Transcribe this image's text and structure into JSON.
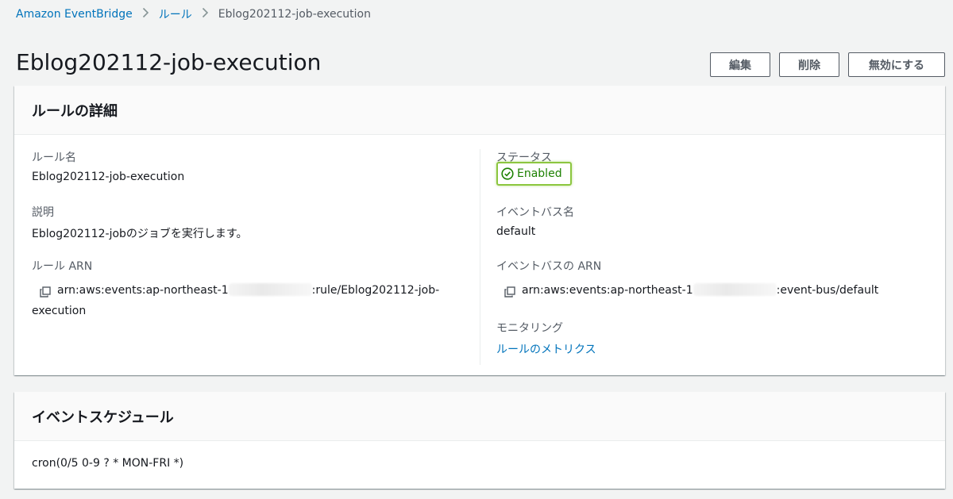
{
  "breadcrumb": {
    "root": "Amazon EventBridge",
    "rules": "ルール",
    "current": "Eblog202112-job-execution"
  },
  "page": {
    "title": "Eblog202112-job-execution"
  },
  "actions": {
    "edit": "編集",
    "delete": "削除",
    "disable": "無効にする"
  },
  "rule_details": {
    "heading": "ルールの詳細",
    "name_label": "ルール名",
    "name_value": "Eblog202112-job-execution",
    "description_label": "説明",
    "description_value": "Eblog202112-jobのジョブを実行します。",
    "arn_label": "ルール ARN",
    "arn_prefix": "arn:aws:events:ap-northeast-1",
    "arn_suffix": ":rule/Eblog202112-job-",
    "arn_wrap": "execution",
    "status_label": "ステータス",
    "status_value": "Enabled",
    "bus_label": "イベントバス名",
    "bus_value": "default",
    "bus_arn_label": "イベントバスの ARN",
    "bus_arn_prefix": "arn:aws:events:ap-northeast-1",
    "bus_arn_suffix": ":event-bus/default",
    "monitoring_label": "モニタリング",
    "monitoring_link": "ルールのメトリクス"
  },
  "schedule": {
    "heading": "イベントスケジュール",
    "expression": "cron(0/5 0-9 ? * MON-FRI *)"
  },
  "colors": {
    "link": "#0073bb",
    "success": "#1d8102",
    "highlight": "#8cc63f"
  }
}
